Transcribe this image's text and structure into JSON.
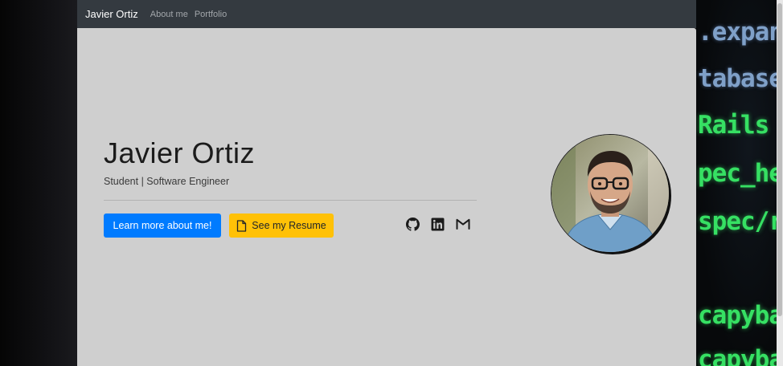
{
  "navbar": {
    "brand": "Javier Ortiz",
    "links": [
      "About me",
      "Portfolio"
    ]
  },
  "hero": {
    "title": "Javier Ortiz",
    "subtitle": "Student | Software Engineer",
    "primary_button": "Learn more about me!",
    "resume_button": "See my Resume",
    "resume_icon": "document-icon",
    "social_icons": [
      "github-icon",
      "linkedin-icon",
      "gmail-icon"
    ],
    "avatar_alt": "profile-photo"
  },
  "background_code": {
    "lines": [
      ".expand",
      "tabase",
      "Rails e",
      "pec_hel",
      "spec/r",
      "capyba",
      "capyba"
    ]
  },
  "colors": {
    "navbar": "#343a40",
    "panel": "#cfcfcf",
    "primary": "#007bff",
    "warning": "#ffc107",
    "code_green": "#36e063"
  }
}
